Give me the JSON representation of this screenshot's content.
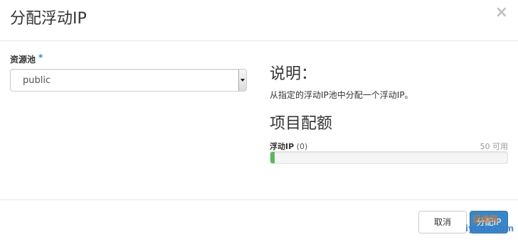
{
  "dialog": {
    "title": "分配浮动IP",
    "close_glyph": "×"
  },
  "form": {
    "pool_label": "资源池",
    "required_marker": "*",
    "pool_selected": "public"
  },
  "description": {
    "heading": "说明：",
    "text": "从指定的浮动IP池中分配一个浮动IP。"
  },
  "quota": {
    "heading": "项目配额",
    "item_label": "浮动IP",
    "item_count": "(0)",
    "available": "50 可用",
    "used_fraction": 0.0,
    "bar_color": "#5cb85c"
  },
  "footer": {
    "cancel_label": "取消",
    "submit_label": "分配IP"
  },
  "watermark": {
    "line1": "运维网",
    "line2": "iyunv.com"
  },
  "colors": {
    "primary": "#3a87c8",
    "required": "#3a87c8"
  }
}
